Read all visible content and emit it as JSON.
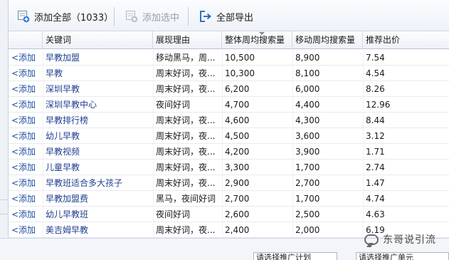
{
  "toolbar": {
    "add_all_label": "添加全部（1033）",
    "add_selected_label": "添加选中",
    "export_all_label": "全部导出"
  },
  "table": {
    "columns": [
      "关键词",
      "展现理由",
      "整体周均搜索量",
      "移动周均搜索量",
      "推荐出价"
    ],
    "add_label": "<添加",
    "rows": [
      {
        "keyword": "早教加盟",
        "reason": "移动黑马，周...",
        "total": "10,500",
        "mobile": "8,900",
        "bid": "7.54"
      },
      {
        "keyword": "早教",
        "reason": "周末好词，夜...",
        "total": "10,300",
        "mobile": "8,100",
        "bid": "4.54"
      },
      {
        "keyword": "深圳早教",
        "reason": "周末好词，夜...",
        "total": "6,200",
        "mobile": "6,000",
        "bid": "8.26"
      },
      {
        "keyword": "深圳早教中心",
        "reason": "夜间好词",
        "total": "4,700",
        "mobile": "4,400",
        "bid": "12.96"
      },
      {
        "keyword": "早教排行榜",
        "reason": "周末好词，夜...",
        "total": "4,600",
        "mobile": "4,300",
        "bid": "8.44"
      },
      {
        "keyword": "幼儿早教",
        "reason": "周末好词，夜...",
        "total": "4,500",
        "mobile": "3,600",
        "bid": "3.12"
      },
      {
        "keyword": "早教视频",
        "reason": "周末好词，夜...",
        "total": "4,200",
        "mobile": "3,900",
        "bid": "1.71"
      },
      {
        "keyword": "儿童早教",
        "reason": "周末好词，夜...",
        "total": "3,300",
        "mobile": "1,700",
        "bid": "2.74"
      },
      {
        "keyword": "早教班适合多大孩子",
        "reason": "周末好词，夜...",
        "total": "2,900",
        "mobile": "2,700",
        "bid": "1.47"
      },
      {
        "keyword": "早教加盟费",
        "reason": "黑马，夜间好词",
        "total": "2,700",
        "mobile": "1,700",
        "bid": "4.74"
      },
      {
        "keyword": "幼儿早教班",
        "reason": "夜间好词",
        "total": "2,600",
        "mobile": "2,500",
        "bid": "4.63"
      },
      {
        "keyword": "美吉姆早教",
        "reason": "周末好词，夜...",
        "total": "2,400",
        "mobile": "2,000",
        "bid": "6.19"
      }
    ]
  },
  "bottom": {
    "combo1": "请选择推广计划",
    "combo2": "请选择推广单元"
  },
  "watermark": {
    "text": "东哥说引流"
  },
  "colors": {
    "link": "#1f4fa3",
    "header_bg": "#edf1f6",
    "export_icon": "#1d62b8"
  }
}
